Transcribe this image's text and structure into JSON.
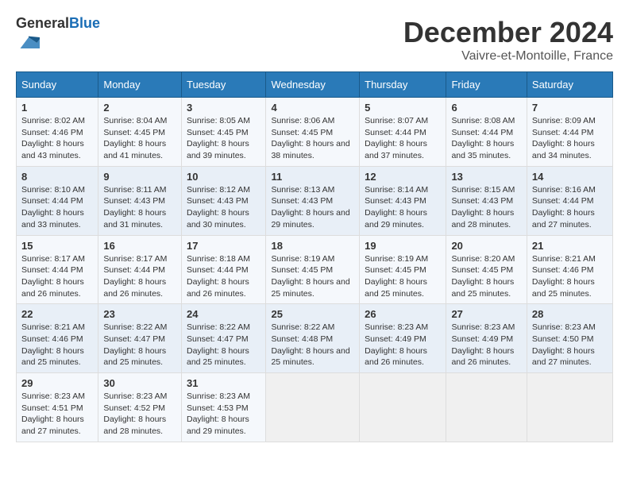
{
  "logo": {
    "general": "General",
    "blue": "Blue"
  },
  "header": {
    "month": "December 2024",
    "location": "Vaivre-et-Montoille, France"
  },
  "days_of_week": [
    "Sunday",
    "Monday",
    "Tuesday",
    "Wednesday",
    "Thursday",
    "Friday",
    "Saturday"
  ],
  "weeks": [
    [
      {
        "day": "1",
        "sunrise": "8:02 AM",
        "sunset": "4:46 PM",
        "daylight": "8 hours and 43 minutes."
      },
      {
        "day": "2",
        "sunrise": "8:04 AM",
        "sunset": "4:45 PM",
        "daylight": "8 hours and 41 minutes."
      },
      {
        "day": "3",
        "sunrise": "8:05 AM",
        "sunset": "4:45 PM",
        "daylight": "8 hours and 39 minutes."
      },
      {
        "day": "4",
        "sunrise": "8:06 AM",
        "sunset": "4:45 PM",
        "daylight": "8 hours and 38 minutes."
      },
      {
        "day": "5",
        "sunrise": "8:07 AM",
        "sunset": "4:44 PM",
        "daylight": "8 hours and 37 minutes."
      },
      {
        "day": "6",
        "sunrise": "8:08 AM",
        "sunset": "4:44 PM",
        "daylight": "8 hours and 35 minutes."
      },
      {
        "day": "7",
        "sunrise": "8:09 AM",
        "sunset": "4:44 PM",
        "daylight": "8 hours and 34 minutes."
      }
    ],
    [
      {
        "day": "8",
        "sunrise": "8:10 AM",
        "sunset": "4:44 PM",
        "daylight": "8 hours and 33 minutes."
      },
      {
        "day": "9",
        "sunrise": "8:11 AM",
        "sunset": "4:43 PM",
        "daylight": "8 hours and 31 minutes."
      },
      {
        "day": "10",
        "sunrise": "8:12 AM",
        "sunset": "4:43 PM",
        "daylight": "8 hours and 30 minutes."
      },
      {
        "day": "11",
        "sunrise": "8:13 AM",
        "sunset": "4:43 PM",
        "daylight": "8 hours and 29 minutes."
      },
      {
        "day": "12",
        "sunrise": "8:14 AM",
        "sunset": "4:43 PM",
        "daylight": "8 hours and 29 minutes."
      },
      {
        "day": "13",
        "sunrise": "8:15 AM",
        "sunset": "4:43 PM",
        "daylight": "8 hours and 28 minutes."
      },
      {
        "day": "14",
        "sunrise": "8:16 AM",
        "sunset": "4:44 PM",
        "daylight": "8 hours and 27 minutes."
      }
    ],
    [
      {
        "day": "15",
        "sunrise": "8:17 AM",
        "sunset": "4:44 PM",
        "daylight": "8 hours and 26 minutes."
      },
      {
        "day": "16",
        "sunrise": "8:17 AM",
        "sunset": "4:44 PM",
        "daylight": "8 hours and 26 minutes."
      },
      {
        "day": "17",
        "sunrise": "8:18 AM",
        "sunset": "4:44 PM",
        "daylight": "8 hours and 26 minutes."
      },
      {
        "day": "18",
        "sunrise": "8:19 AM",
        "sunset": "4:45 PM",
        "daylight": "8 hours and 25 minutes."
      },
      {
        "day": "19",
        "sunrise": "8:19 AM",
        "sunset": "4:45 PM",
        "daylight": "8 hours and 25 minutes."
      },
      {
        "day": "20",
        "sunrise": "8:20 AM",
        "sunset": "4:45 PM",
        "daylight": "8 hours and 25 minutes."
      },
      {
        "day": "21",
        "sunrise": "8:21 AM",
        "sunset": "4:46 PM",
        "daylight": "8 hours and 25 minutes."
      }
    ],
    [
      {
        "day": "22",
        "sunrise": "8:21 AM",
        "sunset": "4:46 PM",
        "daylight": "8 hours and 25 minutes."
      },
      {
        "day": "23",
        "sunrise": "8:22 AM",
        "sunset": "4:47 PM",
        "daylight": "8 hours and 25 minutes."
      },
      {
        "day": "24",
        "sunrise": "8:22 AM",
        "sunset": "4:47 PM",
        "daylight": "8 hours and 25 minutes."
      },
      {
        "day": "25",
        "sunrise": "8:22 AM",
        "sunset": "4:48 PM",
        "daylight": "8 hours and 25 minutes."
      },
      {
        "day": "26",
        "sunrise": "8:23 AM",
        "sunset": "4:49 PM",
        "daylight": "8 hours and 26 minutes."
      },
      {
        "day": "27",
        "sunrise": "8:23 AM",
        "sunset": "4:49 PM",
        "daylight": "8 hours and 26 minutes."
      },
      {
        "day": "28",
        "sunrise": "8:23 AM",
        "sunset": "4:50 PM",
        "daylight": "8 hours and 27 minutes."
      }
    ],
    [
      {
        "day": "29",
        "sunrise": "8:23 AM",
        "sunset": "4:51 PM",
        "daylight": "8 hours and 27 minutes."
      },
      {
        "day": "30",
        "sunrise": "8:23 AM",
        "sunset": "4:52 PM",
        "daylight": "8 hours and 28 minutes."
      },
      {
        "day": "31",
        "sunrise": "8:23 AM",
        "sunset": "4:53 PM",
        "daylight": "8 hours and 29 minutes."
      },
      null,
      null,
      null,
      null
    ]
  ],
  "labels": {
    "sunrise": "Sunrise:",
    "sunset": "Sunset:",
    "daylight": "Daylight:"
  }
}
